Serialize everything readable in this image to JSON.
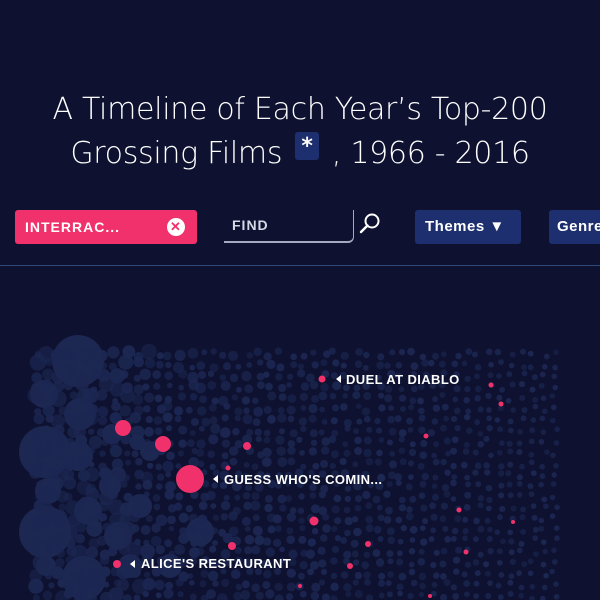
{
  "title": {
    "line1": "A Timeline of Each Year’s Top-200",
    "line2_start": "Grossing Films",
    "asterisk": "*",
    "line2_end": ", 1966 - 2016"
  },
  "controls": {
    "active_filter": "INTERRAC...",
    "clear_icon": "close-icon",
    "find_placeholder": "FIND",
    "find_value": "",
    "themes_label": "Themes ▼",
    "genre_label": "Genre"
  },
  "films": {
    "duel": "DUEL AT DIABLO",
    "guess": "GUESS WHO'S COMIN...",
    "alice": "ALICE'S RESTAURANT"
  },
  "colors": {
    "background": "#0e1230",
    "accent_pink": "#f0316b",
    "button_navy": "#1d2f6e",
    "bubble": "#1c2752"
  }
}
